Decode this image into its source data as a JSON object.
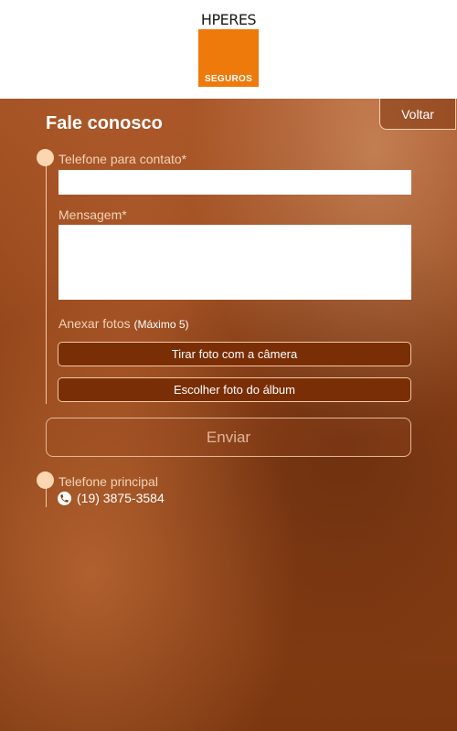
{
  "logo": {
    "brand": "HPERES",
    "sub": "SEGUROS"
  },
  "nav": {
    "back_label": "Voltar"
  },
  "page": {
    "title": "Fale conosco"
  },
  "form": {
    "phone_label": "Telefone para contato*",
    "phone_value": "",
    "message_label": "Mensagem*",
    "message_value": "",
    "attach_label": "Anexar fotos",
    "attach_hint": "(Máximo 5)",
    "camera_button": "Tirar foto com a câmera",
    "album_button": "Escolher foto do álbum",
    "send_button": "Enviar"
  },
  "contact": {
    "main_phone_label": "Telefone principal",
    "main_phone_number": "(19) 3875-3584"
  },
  "colors": {
    "brand_orange": "#ee7a0c",
    "button_dark": "#7a2e06",
    "accent_dot": "#fbd6b0"
  },
  "icons": {
    "phone": "phone-icon"
  }
}
